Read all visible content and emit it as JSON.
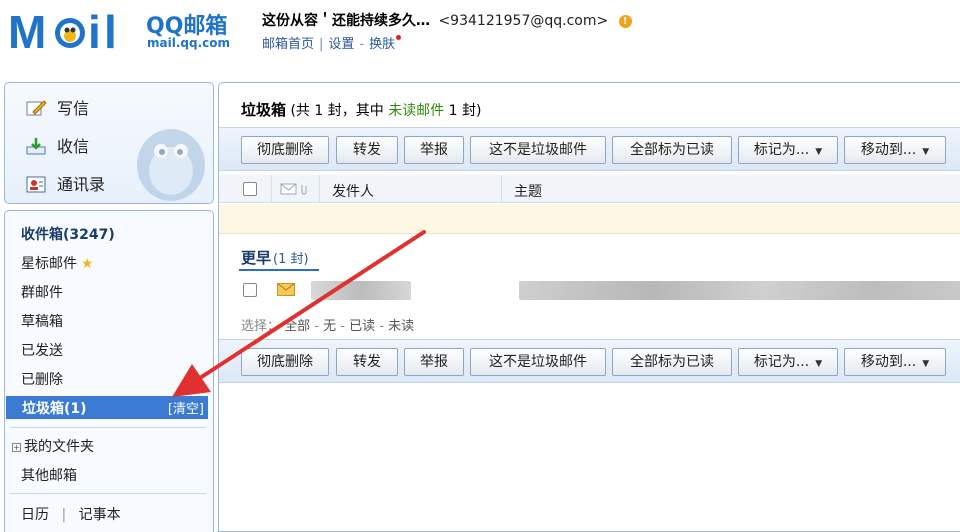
{
  "header": {
    "logo_brand": "QQ邮箱",
    "logo_url": "mail.qq.com",
    "user_name": "这份从容＇还能持续多久…",
    "user_email": "<934121957@qq.com>",
    "warning_mark": "!",
    "links": [
      "邮箱首页",
      "设置",
      "换肤"
    ],
    "sep_bar": "|",
    "sep_dash": "-"
  },
  "sidebar": {
    "actions": [
      "写信",
      "收信",
      "通讯录"
    ],
    "folders": {
      "inbox": "收件箱(3247)",
      "starred": "星标邮件",
      "group": "群邮件",
      "drafts": "草稿箱",
      "sent": "已发送",
      "deleted": "已删除",
      "spam": "垃圾箱(1)",
      "spam_clear": "[清空]",
      "my_folders": "我的文件夹",
      "other": "其他邮箱",
      "calendar": "日历",
      "notes": "记事本"
    },
    "star_icon": "★",
    "plus_icon": "+",
    "bottom_sep": "|"
  },
  "main": {
    "title_folder": "垃圾箱",
    "title_count_pre": "(共 1 封，其中",
    "title_unread": "未读邮件",
    "title_count_post": "1 封)",
    "toolbar_buttons": [
      "彻底删除",
      "转发",
      "举报",
      "这不是垃圾邮件",
      "全部标为已读",
      "标记为...",
      "移动到..."
    ],
    "caret": "▼",
    "columns": {
      "sender": "发件人",
      "subject": "主题"
    },
    "group_label": "更早",
    "group_count": "(1 封)",
    "select_label": "选择：",
    "select_options": [
      "全部",
      "无",
      "已读",
      "未读"
    ],
    "select_sep": "-"
  },
  "colors": {
    "accent": "#3b7bd3",
    "unread_green": "#2f8f0a",
    "arrow_red": "#e03030",
    "link_blue": "#2a5a9a"
  }
}
